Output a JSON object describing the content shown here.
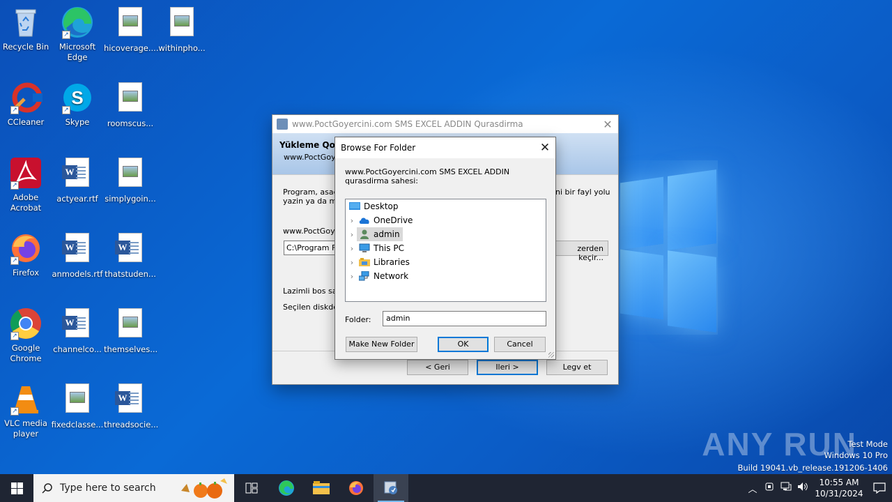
{
  "desktop_icons": [
    {
      "label": "Recycle Bin"
    },
    {
      "label": "Microsoft Edge"
    },
    {
      "label": "hicoverage...."
    },
    {
      "label": "withinpho..."
    },
    {
      "label": "CCleaner"
    },
    {
      "label": "Skype"
    },
    {
      "label": "roomscus..."
    },
    {
      "label": "Adobe Acrobat"
    },
    {
      "label": "actyear.rtf"
    },
    {
      "label": "simplygoin..."
    },
    {
      "label": "Firefox"
    },
    {
      "label": "anmodels.rtf"
    },
    {
      "label": "thatstuden..."
    },
    {
      "label": "Google Chrome"
    },
    {
      "label": "channelco..."
    },
    {
      "label": "themselves..."
    },
    {
      "label": "VLC media player"
    },
    {
      "label": "fixedclasse..."
    },
    {
      "label": "threadsocie..."
    }
  ],
  "installer": {
    "title": "www.PoctGoyercini.com SMS EXCEL ADDIN Qurasdirma",
    "header_title": "Yükleme Qovl",
    "header_subtitle": "www.PoctGoye",
    "intro_left": "Program, asagi",
    "intro_left2": "yazin ya da mov",
    "intro_right": "ni bir fayl yolu",
    "folder_label": "www.PoctGoye",
    "path_value": "C:\\Program File",
    "browse_button": "zerden keçir...",
    "space_required": "Lazimli bos sahe",
    "space_available": "Seçilen diskde i",
    "back_button": "< Geri",
    "next_button": "Ileri >",
    "cancel_button": "Legv et"
  },
  "browse_dialog": {
    "title": "Browse For Folder",
    "description": "www.PoctGoyercini.com SMS EXCEL ADDIN qurasdirma sahesi:",
    "tree": [
      {
        "label": "Desktop",
        "icon": "desktop-icon",
        "expandable": false
      },
      {
        "label": "OneDrive",
        "icon": "cloud-icon",
        "expandable": true
      },
      {
        "label": "admin",
        "icon": "user-icon",
        "expandable": true,
        "selected": true
      },
      {
        "label": "This PC",
        "icon": "computer-icon",
        "expandable": true
      },
      {
        "label": "Libraries",
        "icon": "library-icon",
        "expandable": true
      },
      {
        "label": "Network",
        "icon": "network-icon",
        "expandable": true
      }
    ],
    "folder_label": "Folder:",
    "folder_value": "admin",
    "make_new_folder": "Make New Folder",
    "ok": "OK",
    "cancel": "Cancel"
  },
  "watermark": {
    "brand": "ANY RUN",
    "line1": "Test Mode",
    "line2": "Windows 10 Pro",
    "line3": "Build 19041.vb_release.191206-1406"
  },
  "taskbar": {
    "search_placeholder": "Type here to search",
    "time": "10:55 AM",
    "date": "10/31/2024"
  }
}
